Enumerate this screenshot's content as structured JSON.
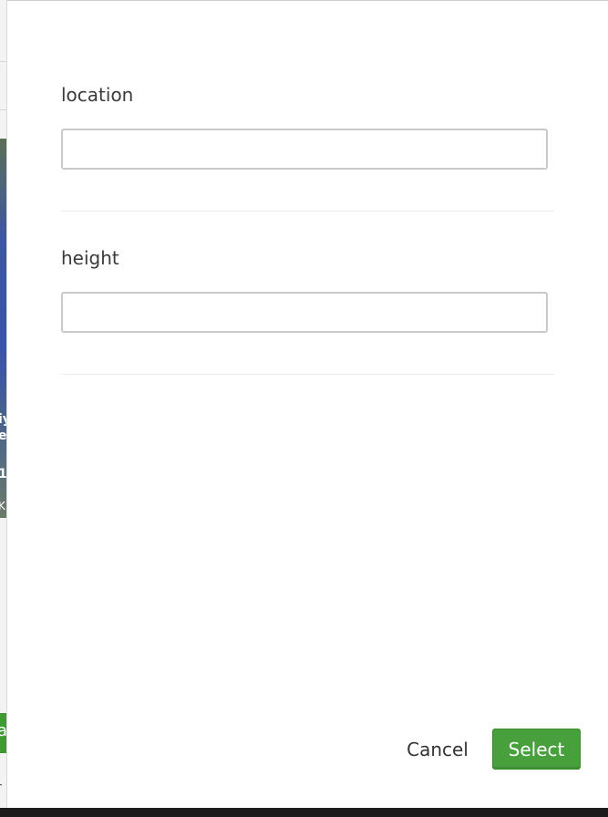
{
  "dialog": {
    "fields": [
      {
        "label": "location",
        "value": "",
        "placeholder": ""
      },
      {
        "label": "height",
        "value": "",
        "placeholder": ""
      }
    ],
    "buttons": {
      "cancel_label": "Cancel",
      "select_label": "Select"
    }
  },
  "background_page": {
    "image_text_1": "iy",
    "image_text_2": "e",
    "image_text_3": "1",
    "image_text_4": "KI",
    "green_button_text": "a",
    "bottom_text": "r"
  },
  "colors": {
    "primary_button": "#47a03c",
    "input_border": "#c9c9c9",
    "label_text": "#3b3b3b"
  }
}
